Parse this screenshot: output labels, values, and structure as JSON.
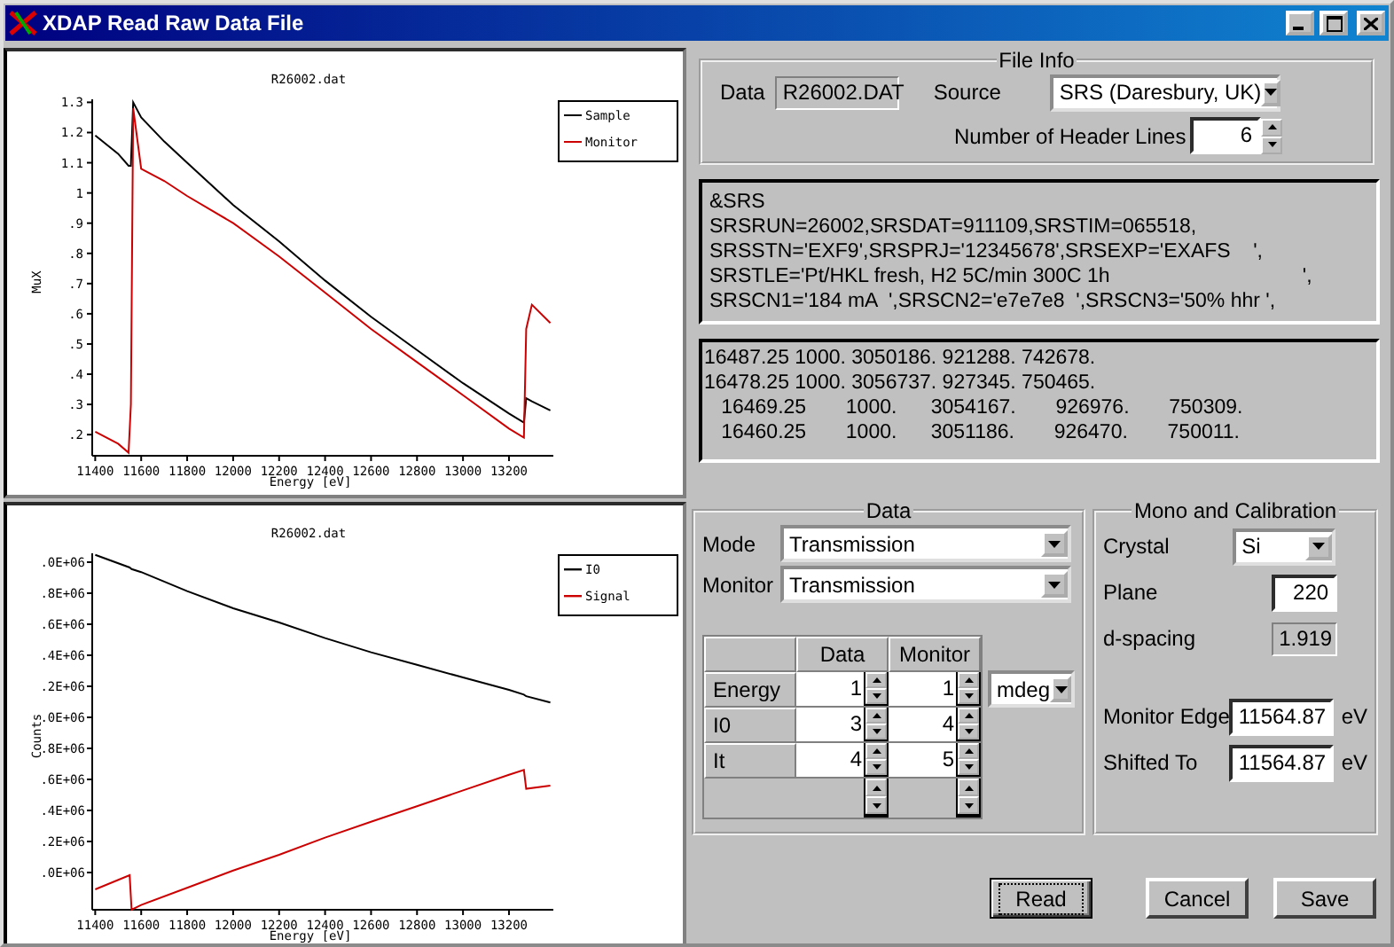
{
  "window": {
    "title": "XDAP Read Raw Data File"
  },
  "charts": [
    {
      "chart_data": {
        "type": "line",
        "title": "R26002.dat",
        "xlabel": "Energy [eV]",
        "ylabel": "MuX",
        "legend": true,
        "xlim": [
          11387,
          13393
        ],
        "ylim": [
          0.13,
          1.31
        ],
        "xticks": [
          11400,
          11600,
          11800,
          12000,
          12200,
          12400,
          12600,
          12800,
          13000,
          13200
        ],
        "yticks": [
          {
            "value": 1.3,
            "label": "1.3"
          },
          {
            "value": 1.2,
            "label": "1.2"
          },
          {
            "value": 1.1,
            "label": "1.1"
          },
          {
            "value": 1,
            "label": "1"
          },
          {
            "value": 0.9,
            "label": ".9"
          },
          {
            "value": 0.8,
            "label": ".8"
          },
          {
            "value": 0.7,
            "label": ".7"
          },
          {
            "value": 0.6,
            "label": ".6"
          },
          {
            "value": 0.5,
            "label": ".5"
          },
          {
            "value": 0.4,
            "label": ".4"
          },
          {
            "value": 0.3,
            "label": ".3"
          },
          {
            "value": 0.2,
            "label": ".2"
          }
        ],
        "x": [
          11400,
          11500,
          11545,
          11555,
          11565,
          11600,
          11700,
          11800,
          12000,
          12200,
          12400,
          12600,
          12800,
          13000,
          13200,
          13265,
          13275,
          13300,
          13380
        ],
        "series": [
          {
            "name": "Sample",
            "color": "#000000",
            "values": [
              1.19,
              1.13,
              1.09,
              1.09,
              1.3,
              1.25,
              1.17,
              1.1,
              0.96,
              0.84,
              0.71,
              0.59,
              0.48,
              0.37,
              0.27,
              0.24,
              0.32,
              0.31,
              0.28
            ]
          },
          {
            "name": "Monitor",
            "color": "#cc0000",
            "values": [
              0.21,
              0.17,
              0.14,
              0.3,
              1.28,
              1.08,
              1.04,
              0.99,
              0.9,
              0.79,
              0.67,
              0.55,
              0.44,
              0.33,
              0.22,
              0.19,
              0.55,
              0.63,
              0.57
            ]
          }
        ]
      }
    },
    {
      "plot": {
        "title": "R26002.dat",
        "xlabel": "Energy [eV]",
        "ylabel": "Counts",
        "xtick_labels": [
          "11400",
          "11600",
          "11800",
          "12000",
          "12200",
          "12400",
          "12600",
          "12800",
          "13000",
          "13200"
        ],
        "ytick_labels": [
          ".0E+06",
          ".8E+06",
          ".6E+06",
          ".4E+06",
          ".2E+06",
          ".0E+06",
          ".8E+06",
          ".6E+06",
          ".4E+06",
          ".2E+06",
          ".0E+06"
        ],
        "legend": [
          {
            "name": "I0",
            "color": "#000000"
          },
          {
            "name": "Signal",
            "color": "#cc0000"
          }
        ]
      }
    }
  ],
  "file_info": {
    "title": "File Info",
    "data_label": "Data",
    "data_value": "R26002.DAT",
    "source_label": "Source",
    "source_value": "SRS (Daresbury, UK)",
    "header_lines_label": "Number of Header Lines",
    "header_lines_value": "6"
  },
  "header_text": [
    "&SRS",
    "SRSRUN=26002,SRSDAT=911109,SRSTIM=065518,",
    "SRSSTN='EXF9',SRSPRJ='12345678',SRSEXP='EXAFS    ',",
    "SRSTLE='Pt/HKL fresh, H2 5C/min 300C 1h                                  ',",
    "SRSCN1='184 mA  ',SRSCN2='e7e7e8  ',SRSCN3='50% hhr ',"
  ],
  "data_preview": [
    "16487.25 1000. 3050186. 921288. 742678.",
    "16478.25 1000. 3056737. 927345. 750465.",
    "   16469.25       1000.      3054167.       926976.       750309.",
    "   16460.25       1000.      3051186.       926470.       750011."
  ],
  "data_group": {
    "title": "Data",
    "mode_label": "Mode",
    "mode_value": "Transmission",
    "monitor_label": "Monitor",
    "monitor_value": "Transmission",
    "columns": [
      "Data",
      "Monitor"
    ],
    "rows": [
      {
        "label": "Energy",
        "data": "1",
        "monitor": "1"
      },
      {
        "label": "I0",
        "data": "3",
        "monitor": "4"
      },
      {
        "label": "It",
        "data": "4",
        "monitor": "5"
      }
    ],
    "unit": "mdeg"
  },
  "mono": {
    "title": "Mono and Calibration",
    "crystal_label": "Crystal",
    "crystal_value": "Si",
    "plane_label": "Plane",
    "plane_value": "220",
    "dspacing_label": "d-spacing",
    "dspacing_value": "1.919",
    "monitor_edge_label": "Monitor Edge",
    "monitor_edge_value": "11564.87",
    "monitor_edge_unit": "eV",
    "shifted_label": "Shifted To",
    "shifted_value": "11564.87",
    "shifted_unit": "eV"
  },
  "buttons": [
    {
      "label": "Read",
      "focused": true
    },
    {
      "label": "Cancel",
      "focused": false
    },
    {
      "label": "Save",
      "focused": false
    }
  ]
}
